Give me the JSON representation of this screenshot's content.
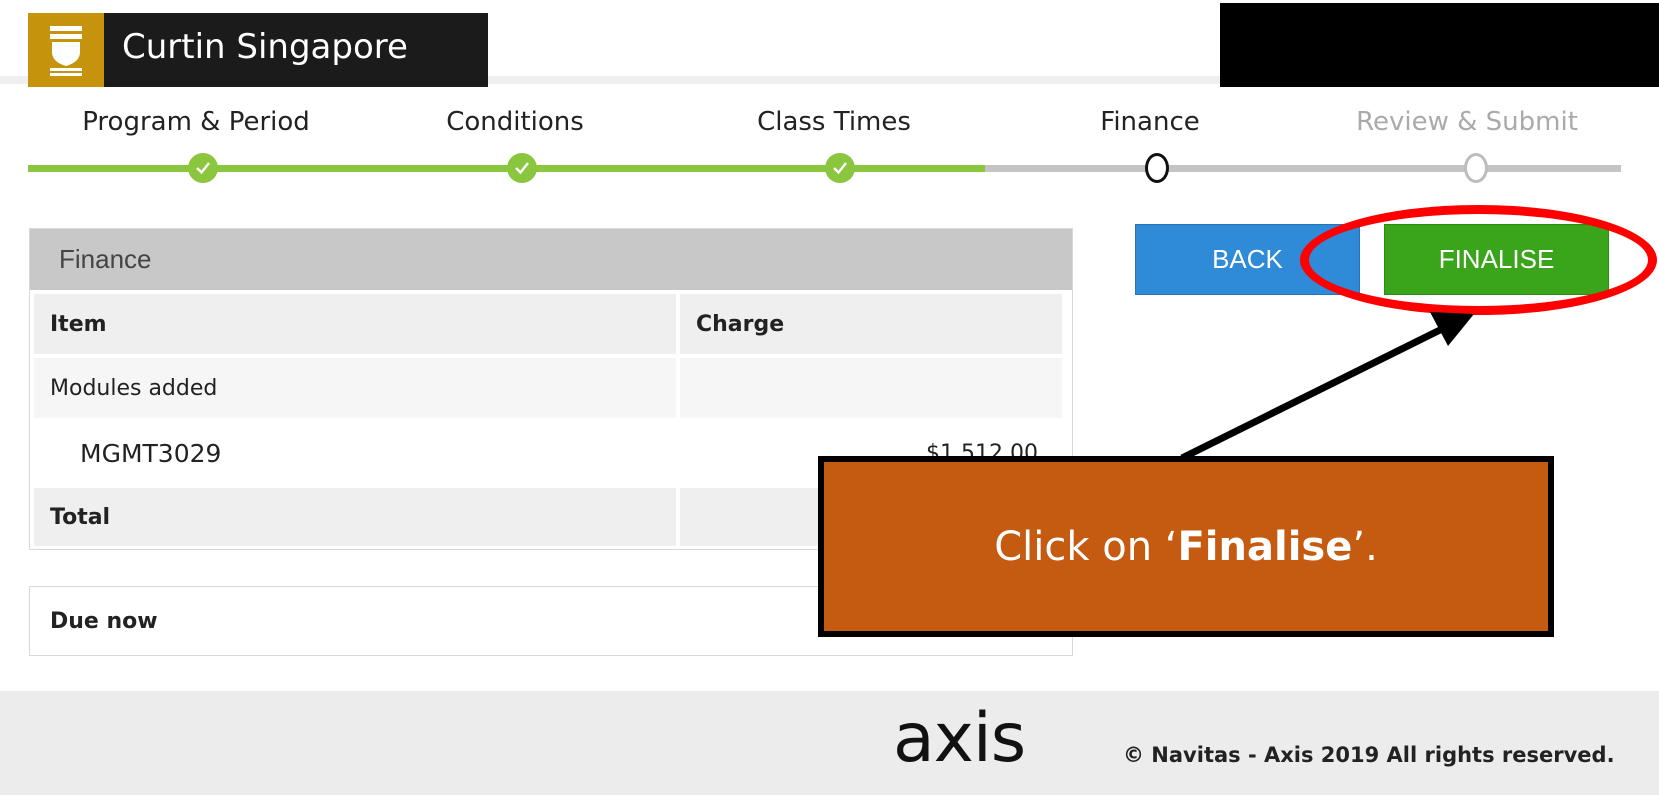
{
  "header": {
    "brand_name": "Curtin Singapore"
  },
  "stepper": {
    "steps": [
      {
        "label": "Program & Period",
        "status": "complete"
      },
      {
        "label": "Conditions",
        "status": "complete"
      },
      {
        "label": "Class Times",
        "status": "complete"
      },
      {
        "label": "Finance",
        "status": "current"
      },
      {
        "label": "Review & Submit",
        "status": "upcoming"
      }
    ],
    "colors": {
      "complete": "#8bc63f",
      "upcoming": "#c4c4c4"
    }
  },
  "finance": {
    "title": "Finance",
    "columns": [
      "Item",
      "Charge"
    ],
    "group_label": "Modules added",
    "items": [
      {
        "name": "MGMT3029",
        "charge": "$1,512.00"
      }
    ],
    "total_label": "Total",
    "due_now_label": "Due now"
  },
  "actions": {
    "back_label": "BACK",
    "finalise_label": "FINALISE",
    "back_color": "#2f8ad8",
    "finalise_color": "#3aa41b"
  },
  "annotation": {
    "callout_prefix": "Click on ‘",
    "callout_bold": "Finalise",
    "callout_suffix": "’.",
    "callout_color": "#c55a11",
    "ring_color": "#ff0000"
  },
  "footer": {
    "logo_text": "axis",
    "copyright": "© Navitas - Axis 2019 All rights reserved."
  }
}
